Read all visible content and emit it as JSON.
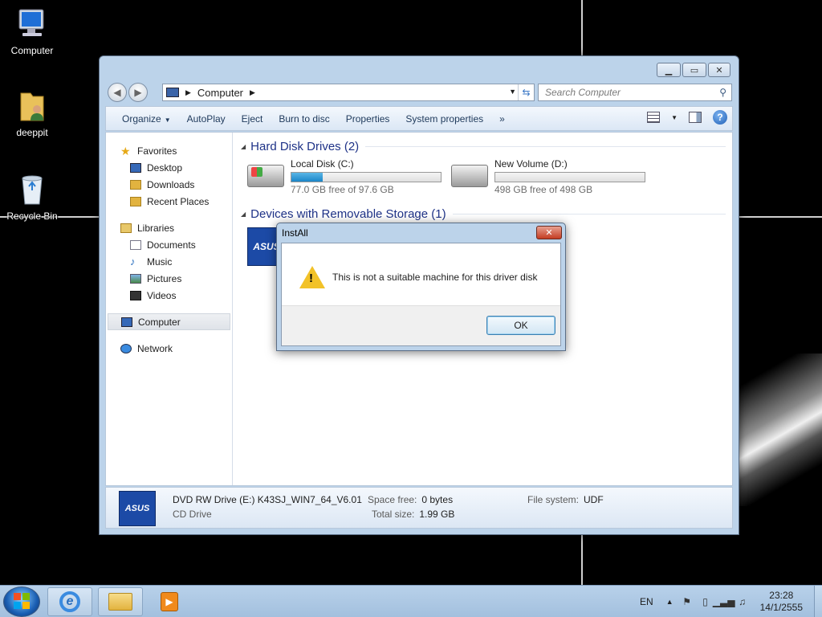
{
  "desktop": {
    "icons": [
      {
        "label": "Computer",
        "icon": "computer-icon"
      },
      {
        "label": "deeppit",
        "icon": "user-folder-icon"
      },
      {
        "label": "Recycle Bin",
        "icon": "recycle-bin-icon"
      }
    ]
  },
  "explorer": {
    "address": {
      "location": "Computer"
    },
    "search": {
      "placeholder": "Search Computer"
    },
    "toolbar": {
      "organize": "Organize",
      "autoplay": "AutoPlay",
      "eject": "Eject",
      "burn": "Burn to disc",
      "properties": "Properties",
      "system_properties": "System properties",
      "more": "»"
    },
    "nav": {
      "favorites": "Favorites",
      "desktop": "Desktop",
      "downloads": "Downloads",
      "recent": "Recent Places",
      "libraries": "Libraries",
      "documents": "Documents",
      "music": "Music",
      "pictures": "Pictures",
      "videos": "Videos",
      "computer": "Computer",
      "network": "Network"
    },
    "groups": {
      "hdd_header": "Hard Disk Drives (2)",
      "removable_header": "Devices with Removable Storage (1)"
    },
    "drives": [
      {
        "name": "Local Disk (C:)",
        "free_text": "77.0 GB free of 97.6 GB",
        "used_fraction": 0.21
      },
      {
        "name": "New Volume (D:)",
        "free_text": "498 GB free of 498 GB",
        "used_fraction": 0.0
      }
    ],
    "removable_icon_text": "ASUS",
    "details": {
      "title": "DVD RW Drive (E:) K43SJ_WIN7_64_V6.01",
      "type": "CD Drive",
      "space_free_label": "Space free:",
      "space_free": "0 bytes",
      "total_size_label": "Total size:",
      "total_size": "1.99 GB",
      "fs_label": "File system:",
      "fs": "UDF",
      "icon_text": "ASUS"
    }
  },
  "dialog": {
    "title": "InstAll",
    "message": "This is not a suitable machine for this driver disk",
    "ok": "OK",
    "close": "✕"
  },
  "taskbar": {
    "lang": "EN",
    "time": "23:28",
    "date": "14/1/2555"
  }
}
